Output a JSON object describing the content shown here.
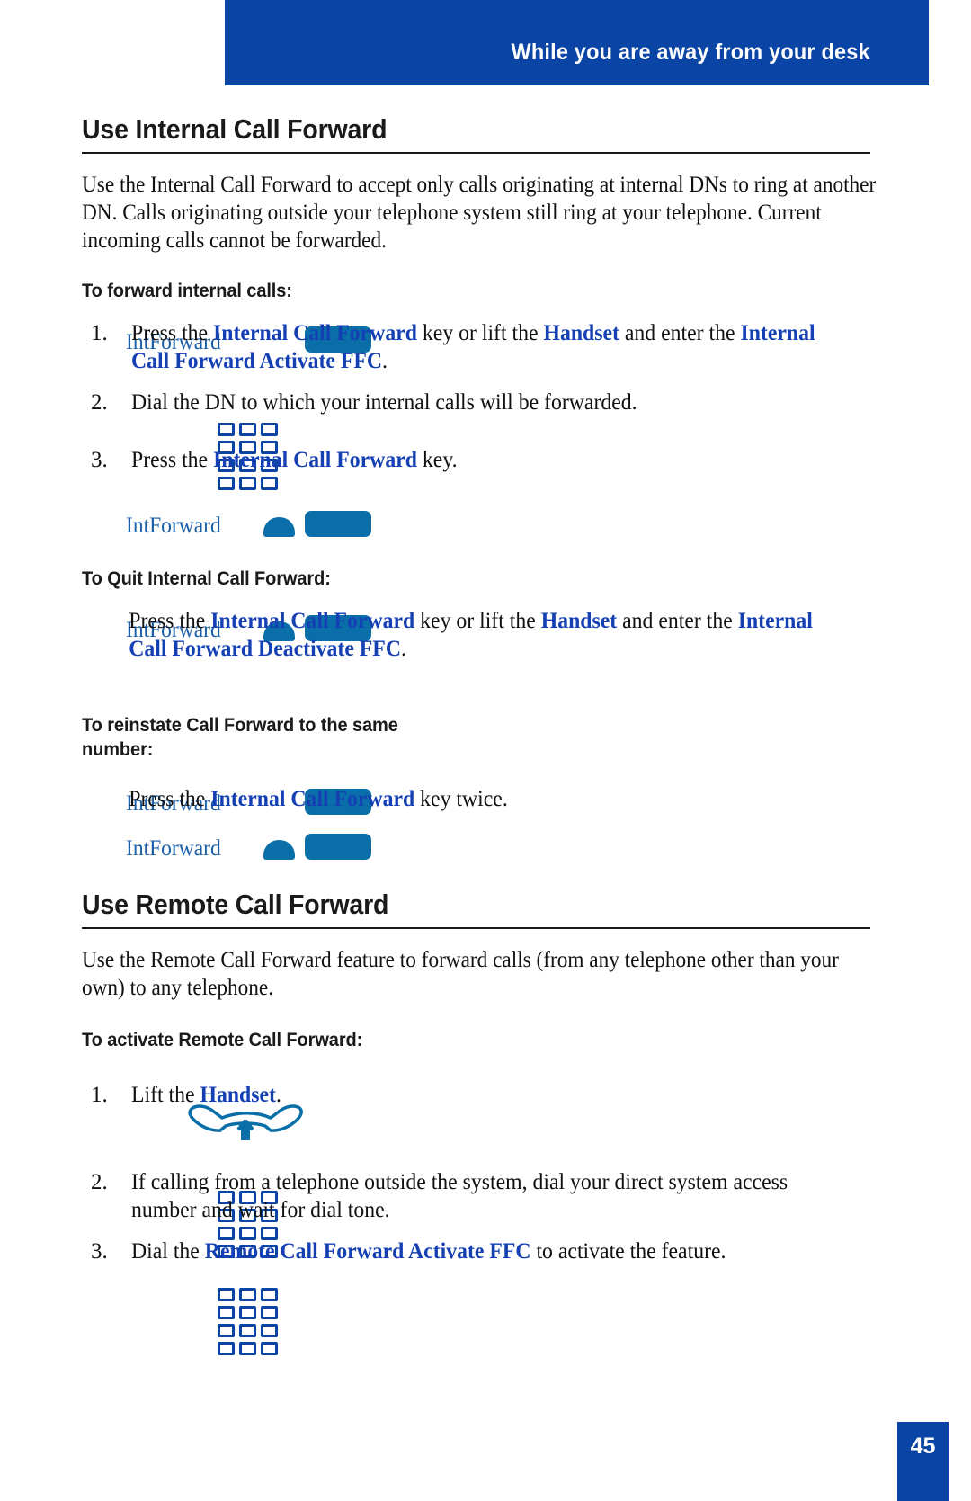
{
  "header": {
    "running_title": "While you are away from your desk",
    "banner_color": "#0a45a5"
  },
  "colors": {
    "banner_blue": "#0a45a5",
    "highlight_blue": "#1440b4",
    "softkey_label_blue": "#1b5fa8",
    "button_blue": "#0a6fa8"
  },
  "sections": [
    {
      "title": "Use Internal Call Forward",
      "intro": "Use the Internal Call Forward to accept only calls originating at internal DNs to ring at another DN. Calls originating outside your telephone system still ring at your telephone. Current incoming calls cannot be forwarded.",
      "subsections": [
        {
          "heading": "To forward internal calls:",
          "icons": [
            {
              "type": "softkey-label",
              "label": "IntForward"
            },
            {
              "type": "key-button",
              "label": "feature-key"
            },
            {
              "type": "keypad",
              "label": "dial-keypad"
            },
            {
              "type": "handset-arc",
              "label": "handset"
            }
          ],
          "steps": [
            {
              "number": "1.",
              "text": "Press the Internal Call Forward key or lift the Handset and enter the Internal Call Forward Activate FFC."
            },
            {
              "number": "2.",
              "text": "Dial the DN to which your internal calls will be forwarded."
            },
            {
              "number": "3.",
              "text": "Press the Internal Call Forward key."
            }
          ]
        },
        {
          "heading": "To Quit Internal Call Forward:",
          "icons": [
            {
              "type": "softkey-label",
              "label": "IntForward"
            },
            {
              "type": "handset-arc",
              "label": "handset"
            },
            {
              "type": "key-button",
              "label": "feature-key"
            }
          ],
          "steps": [
            {
              "number": "",
              "text": "Press the Internal Call Forward key or lift the Handset and enter the Internal Call Forward Deactivate FFC."
            }
          ]
        },
        {
          "heading": "To reinstate Call Forward to the same number:",
          "icons": [
            {
              "type": "softkey-label",
              "label": "IntForward"
            },
            {
              "type": "key-button",
              "label": "feature-key"
            },
            {
              "type": "softkey-label",
              "label": "IntForward"
            },
            {
              "type": "handset-arc",
              "label": "handset"
            },
            {
              "type": "key-button",
              "label": "feature-key"
            }
          ],
          "steps": [
            {
              "number": "",
              "text": "Press the Internal Call Forward key twice."
            }
          ]
        }
      ]
    },
    {
      "title": "Use Remote Call Forward",
      "intro": "Use the Remote Call Forward feature to forward calls (from any telephone other than your own) to any telephone.",
      "subsections": [
        {
          "heading": "To activate Remote Call Forward:",
          "icons": [
            {
              "type": "handset-lift",
              "label": "lift-handset"
            },
            {
              "type": "keypad",
              "label": "dial-keypad"
            },
            {
              "type": "keypad",
              "label": "dial-keypad"
            }
          ],
          "steps": [
            {
              "number": "1.",
              "text": "Lift the Handset."
            },
            {
              "number": "2.",
              "text": "If calling from a telephone outside the system, dial your direct system access number and wait for dial tone."
            },
            {
              "number": "3.",
              "text": "Dial the Remote Call Forward Activate FFC to activate the feature."
            }
          ]
        }
      ]
    }
  ],
  "rich_text": {
    "s1_step1": [
      {
        "t": "Press the ",
        "b": false
      },
      {
        "t": "Internal Call Forward",
        "b": true
      },
      {
        "t": " key or lift the ",
        "b": false
      },
      {
        "t": "Handset",
        "b": true
      },
      {
        "t": " and enter the ",
        "b": false
      },
      {
        "t": "Internal Call Forward Activate FFC",
        "b": true
      },
      {
        "t": ".",
        "b": false
      }
    ],
    "s1_step2": [
      {
        "t": "Dial the DN to which your internal calls will be forwarded.",
        "b": false
      }
    ],
    "s1_step3": [
      {
        "t": "Press the ",
        "b": false
      },
      {
        "t": "Internal Call Forward",
        "b": true
      },
      {
        "t": " key.",
        "b": false
      }
    ],
    "s2_step1": [
      {
        "t": "Press the ",
        "b": false
      },
      {
        "t": "Internal Call Forward",
        "b": true
      },
      {
        "t": " key or lift the ",
        "b": false
      },
      {
        "t": "Handset",
        "b": true
      },
      {
        "t": " and enter the ",
        "b": false
      },
      {
        "t": "Internal Call Forward Deactivate FFC",
        "b": true
      },
      {
        "t": ".",
        "b": false
      }
    ],
    "s3_step1": [
      {
        "t": "Press the ",
        "b": false
      },
      {
        "t": "Internal Call Forward",
        "b": true
      },
      {
        "t": " key twice.",
        "b": false
      }
    ],
    "s4_step1": [
      {
        "t": "Lift the ",
        "b": false
      },
      {
        "t": "Handset",
        "b": true
      },
      {
        "t": ".",
        "b": false
      }
    ],
    "s4_step2": [
      {
        "t": "If calling from a telephone outside the system, dial your direct system access number and wait for dial tone.",
        "b": false
      }
    ],
    "s4_step3": [
      {
        "t": "Dial the ",
        "b": false
      },
      {
        "t": "Remote Call Forward Activate FFC",
        "b": true
      },
      {
        "t": " to activate the feature.",
        "b": false
      }
    ]
  },
  "footer": {
    "page_number": "45"
  }
}
